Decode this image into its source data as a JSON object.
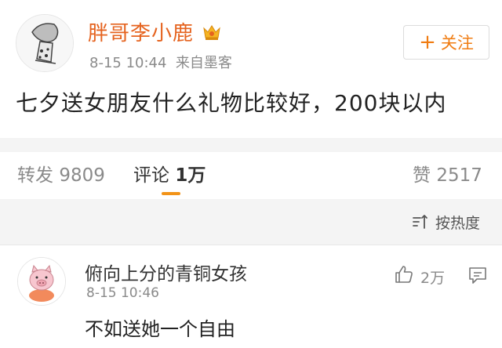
{
  "post": {
    "author": "胖哥李小鹿",
    "time": "8-15 10:44",
    "source": "来自墨客",
    "text": "七夕送女朋友什么礼物比较好，200块以内",
    "follow_label": "关注",
    "avatar_icon": "avatar-icon",
    "badge_icon": "crown-icon"
  },
  "stats": {
    "repost_label": "转发",
    "repost_count": "9809",
    "comment_label": "评论",
    "comment_count": "1万",
    "like_label": "赞",
    "like_count": "2517"
  },
  "sort": {
    "label": "按热度",
    "icon": "sort-icon"
  },
  "comments": [
    {
      "name": "俯向上分的青铜女孩",
      "time": "8-15 10:46",
      "text": "不如送她一个自由",
      "likes": "2万",
      "avatar_icon": "pig-avatar-icon"
    }
  ],
  "colors": {
    "author_name": "#e5631f",
    "follow_accent": "#f07c12",
    "active_underline": "#f29318",
    "band": "#f4f4f4"
  }
}
